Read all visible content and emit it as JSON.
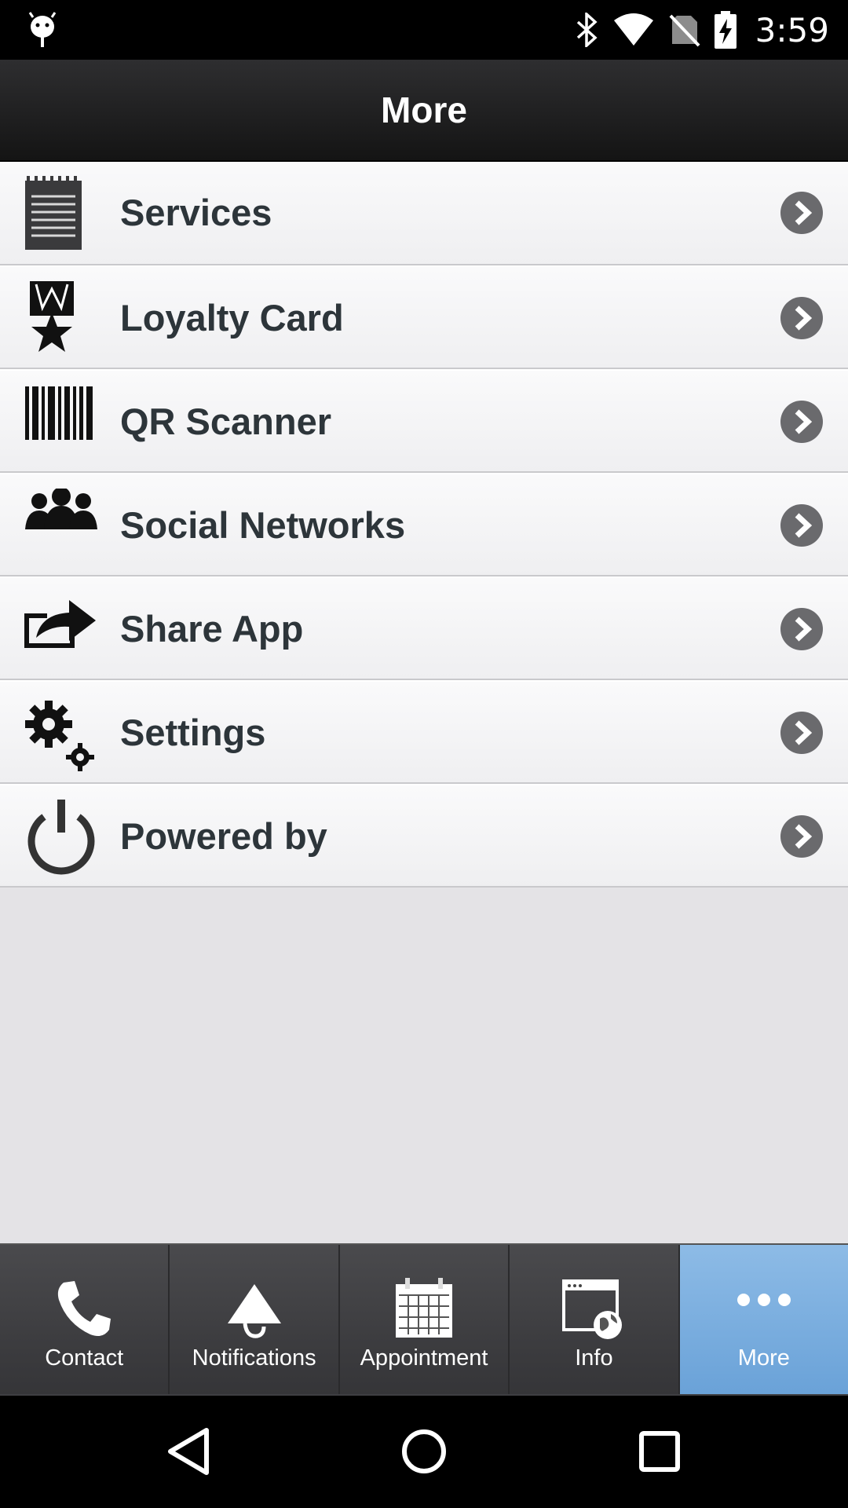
{
  "status_bar": {
    "time": "3:59",
    "icons": [
      "android-debug-icon",
      "bluetooth-icon",
      "wifi-icon",
      "no-sim-icon",
      "battery-charging-icon"
    ]
  },
  "header": {
    "title": "More"
  },
  "menu": {
    "items": [
      {
        "label": "Services",
        "icon": "notepad-icon"
      },
      {
        "label": "Loyalty Card",
        "icon": "medal-star-icon"
      },
      {
        "label": "QR Scanner",
        "icon": "barcode-icon"
      },
      {
        "label": "Social Networks",
        "icon": "group-icon"
      },
      {
        "label": "Share App",
        "icon": "share-arrow-icon"
      },
      {
        "label": "Settings",
        "icon": "gears-icon"
      },
      {
        "label": "Powered by",
        "icon": "power-icon"
      }
    ]
  },
  "tabbar": {
    "tabs": [
      {
        "label": "Contact",
        "icon": "phone-icon"
      },
      {
        "label": "Notifications",
        "icon": "megaphone-icon"
      },
      {
        "label": "Appointment",
        "icon": "calendar-icon"
      },
      {
        "label": "Info",
        "icon": "globe-window-icon"
      },
      {
        "label": "More",
        "icon": "more-dots-icon"
      }
    ],
    "active_tab": "More"
  },
  "nav_bar": {
    "buttons": [
      "back-icon",
      "home-icon",
      "recents-icon"
    ]
  },
  "colors": {
    "accent_active_tab": "#7fb2e2",
    "header_bg": "#1c1c1e",
    "row_text": "#2d353a"
  }
}
